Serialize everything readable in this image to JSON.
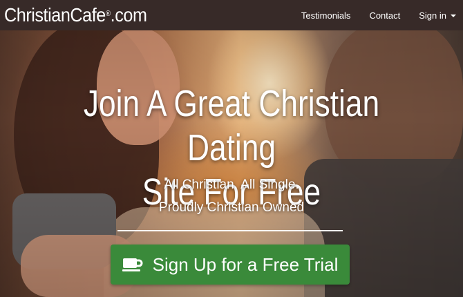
{
  "navbar": {
    "logo": "ChristianCafe",
    "logo_suffix": ".com",
    "logo_mark": "®",
    "links": [
      {
        "label": "Testimonials"
      },
      {
        "label": "Contact"
      },
      {
        "label": "Sign in"
      }
    ]
  },
  "hero": {
    "headline_line1": "Join A Great Christian Dating",
    "headline_line2": "Site For Free",
    "tagline1": "All Christian. All Single.",
    "tagline2": "Proudly Christian Owned",
    "cta_label": "Sign Up for a Free Trial",
    "cta_icon": "coffee-cup-icon"
  },
  "colors": {
    "navbar_bg": "#372a28",
    "cta_bg": "#3a8a3a",
    "text": "#ffffff"
  }
}
